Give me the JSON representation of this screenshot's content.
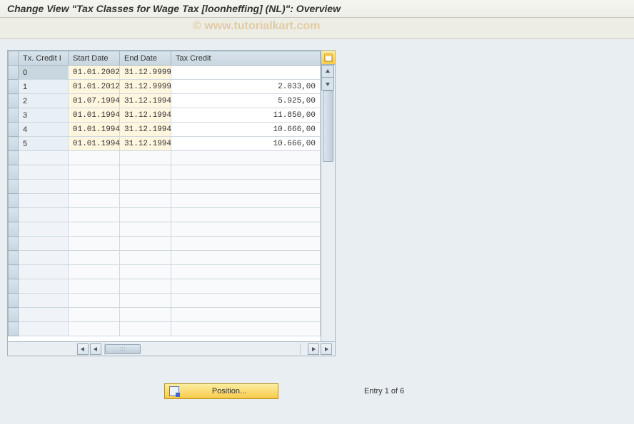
{
  "header": {
    "title": "Change View \"Tax Classes for Wage Tax [loonheffing] (NL)\": Overview"
  },
  "watermark": "© www.tutorialkart.com",
  "grid": {
    "columns": [
      "Tx. Credit I",
      "Start Date",
      "End Date",
      "Tax Credit"
    ],
    "rows": [
      {
        "id": "0",
        "start": "01.01.2002",
        "end": "31.12.9999",
        "credit": ""
      },
      {
        "id": "1",
        "start": "01.01.2012",
        "end": "31.12.9999",
        "credit": "2.033,00"
      },
      {
        "id": "2",
        "start": "01.07.1994",
        "end": "31.12.1994",
        "credit": "5.925,00"
      },
      {
        "id": "3",
        "start": "01.01.1994",
        "end": "31.12.1994",
        "credit": "11.850,00"
      },
      {
        "id": "4",
        "start": "01.01.1994",
        "end": "31.12.1994",
        "credit": "10.666,00"
      },
      {
        "id": "5",
        "start": "01.01.1994",
        "end": "31.12.1994",
        "credit": "10.666,00"
      }
    ],
    "empty_row_count": 13
  },
  "icons": {
    "select_all": "select-all-icon",
    "up": "▲",
    "down": "▼",
    "left": "◀",
    "right": "▶",
    "first": "◀",
    "last": "▶"
  },
  "footer": {
    "position_label": "Position...",
    "entry_text": "Entry 1 of 6"
  }
}
